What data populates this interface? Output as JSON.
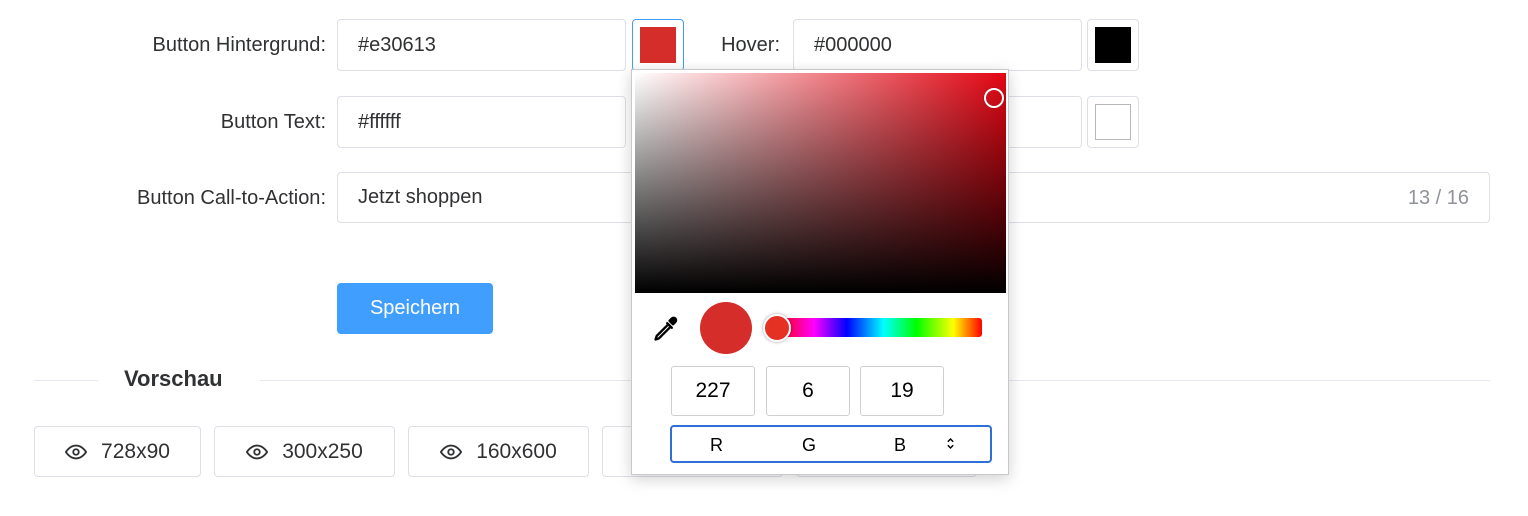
{
  "form": {
    "bg_label": "Button Hintergrund",
    "bg_value": "#e30613",
    "hover_label": "Hover",
    "hover_value": "#000000",
    "text_label": "Button Text",
    "text_value": "#ffffff",
    "cta_label": "Button Call-to-Action",
    "cta_value": "Jetzt shoppen",
    "cta_counter": "13 / 16",
    "colon": ":",
    "save_label": "Speichern"
  },
  "colors": {
    "accent": "#409eff",
    "bg_color": "#e30613",
    "hover_color": "#000000",
    "text_color": "#ffffff",
    "text_hover_color": "#ffffff",
    "picker_preview": "#d52d2a"
  },
  "preview": {
    "title": "Vorschau",
    "buttons": [
      {
        "label": "728x90",
        "icon": "eye-icon"
      },
      {
        "label": "300x250",
        "icon": "eye-icon"
      },
      {
        "label": "160x600",
        "icon": "eye-icon"
      }
    ]
  },
  "picker": {
    "r": "227",
    "g": "6",
    "b": "19",
    "mode_r": "R",
    "mode_g": "G",
    "mode_b": "B",
    "icons": [
      "eyedropper-icon",
      "select-arrows-icon"
    ]
  }
}
